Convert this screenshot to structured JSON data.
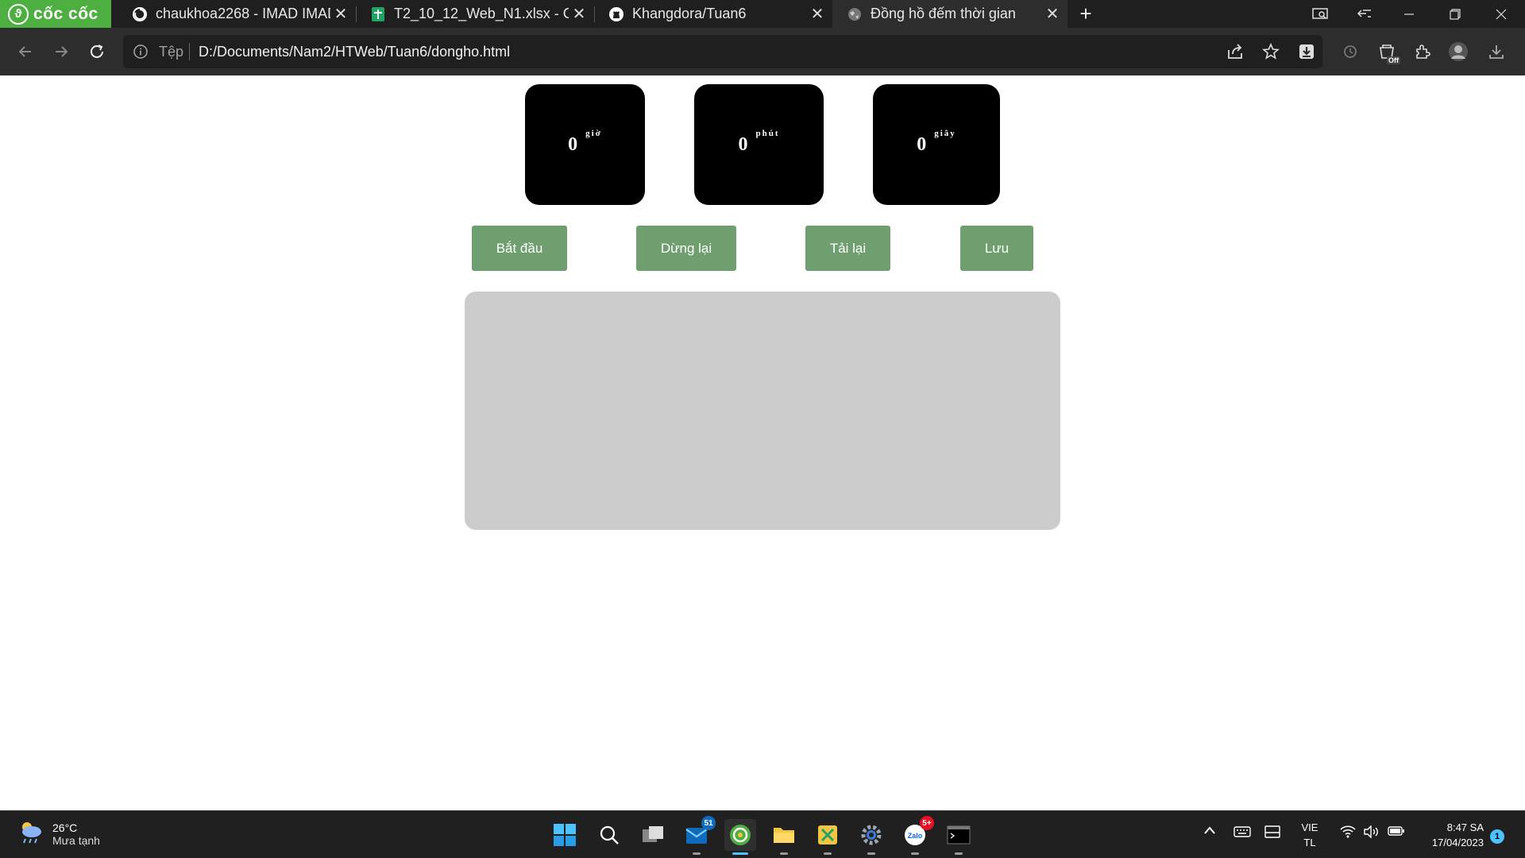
{
  "browser": {
    "brand": "cốc cốc",
    "tabs": [
      {
        "title": "chaukhoa2268 - IMAD IMAD",
        "icon": "reload-circle-icon"
      },
      {
        "title": "T2_10_12_Web_N1.xlsx - Goo",
        "icon": "google-sheets-icon"
      },
      {
        "title": "Khangdora/Tuan6",
        "icon": "github-icon"
      },
      {
        "title": "Đồng hồ đếm thời gian",
        "icon": "globe-icon",
        "active": true
      }
    ],
    "address": {
      "scheme_label": "Tệp",
      "url": "D:/Documents/Nam2/HTWeb/Tuan6/dongho.html"
    },
    "extension_badge": "Off"
  },
  "stopwatch": {
    "hours": {
      "value": "0",
      "unit": "giờ"
    },
    "minutes": {
      "value": "0",
      "unit": "phút"
    },
    "seconds": {
      "value": "0",
      "unit": "giây"
    },
    "buttons": {
      "start": "Bắt đầu",
      "stop": "Dừng lại",
      "reset": "Tải lại",
      "save": "Lưu"
    },
    "colors": {
      "box": "#000000",
      "button": "#6f9f6f",
      "results": "#cccccc"
    }
  },
  "taskbar": {
    "weather": {
      "temp": "26°C",
      "condition": "Mưa tạnh"
    },
    "badges": {
      "mail": "51",
      "zalo": "5+"
    },
    "language": {
      "line1": "VIE",
      "line2": "TL"
    },
    "clock": {
      "time": "8:47 SA",
      "date": "17/04/2023"
    },
    "notifications": "1"
  }
}
